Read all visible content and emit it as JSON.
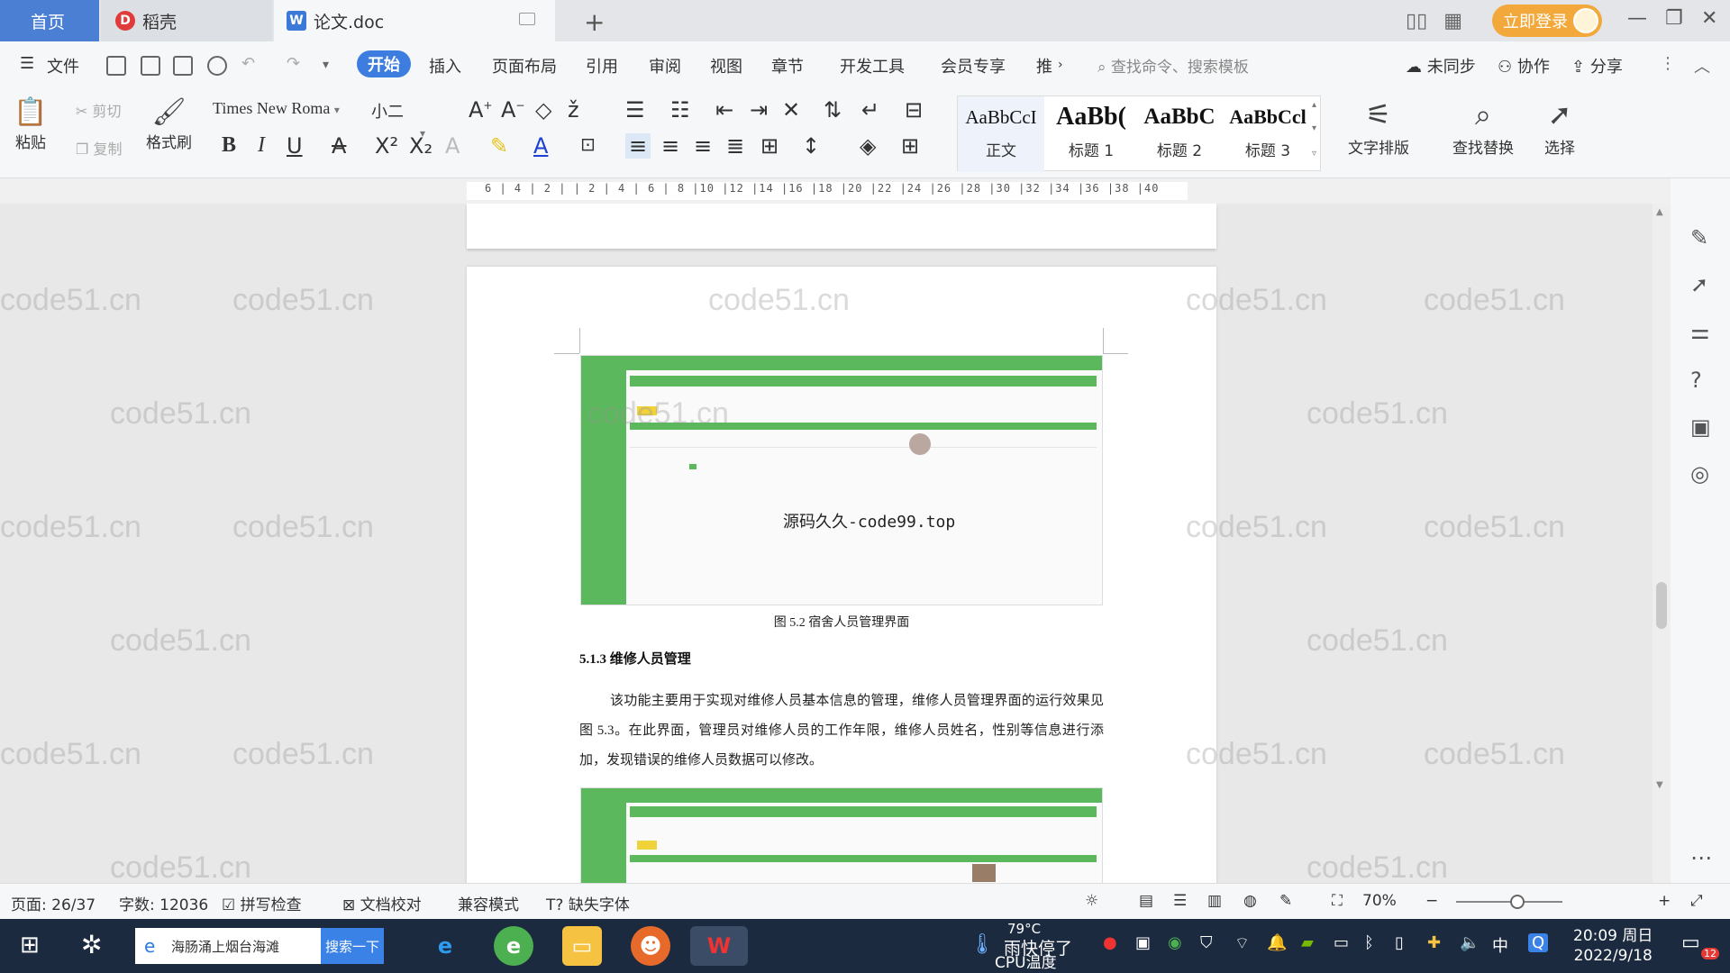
{
  "tabs": {
    "home": "首页",
    "daoke": "稻壳",
    "doc": "论文.doc"
  },
  "titlebar": {
    "login": "立即登录"
  },
  "menu": {
    "file": "文件",
    "items": [
      "开始",
      "插入",
      "页面布局",
      "引用",
      "审阅",
      "视图",
      "章节",
      "开发工具",
      "会员专享",
      "推"
    ],
    "search_cmd": "查找命令、搜索模板",
    "unsynced": "未同步",
    "collab": "协作",
    "share": "分享"
  },
  "ribbon": {
    "paste": "粘贴",
    "cut": "剪切",
    "copy": "复制",
    "format_painter": "格式刷",
    "font_name": "Times New Roma",
    "font_size": "小二",
    "styles": [
      {
        "preview": "AaBbCcI",
        "name": "正文"
      },
      {
        "preview": "AaBb(",
        "name": "标题 1"
      },
      {
        "preview": "AaBbC",
        "name": "标题 2"
      },
      {
        "preview": "AaBbCcl",
        "name": "标题 3"
      }
    ],
    "text_layout": "文字排版",
    "find_replace": "查找替换",
    "select": "选择"
  },
  "ruler": {
    "ticks": "6 | 4 | 2 |   | 2 | 4 | 6 | 8 |10 |12 |14 |16 |18 |20 |22 |24 |26 |28 |30 |32 |34 |36 |38 |40"
  },
  "document": {
    "image_overlay_text": "源码久久-code99.top",
    "figure_caption": "图 5.2  宿舍人员管理界面",
    "section_heading": "5.1.3  维修人员管理",
    "paragraph": "该功能主要用于实现对维修人员基本信息的管理，维修人员管理界面的运行效果见图 5.3。在此界面，管理员对维修人员的工作年限，维修人员姓名，性别等信息进行添加，发现错误的维修人员数据可以修改。",
    "watermark": "code51.cn"
  },
  "statusbar": {
    "page": "页面: 26/37",
    "words": "字数: 12036",
    "spell": "拼写检查",
    "proof": "文档校对",
    "compat": "兼容模式",
    "missing_font": "缺失字体",
    "zoom": "70%"
  },
  "taskbar": {
    "search_text": "海肠涌上烟台海滩",
    "search_btn": "搜索一下",
    "weather_temp": "79°C",
    "weather_text": "雨快停了",
    "cpu_label": "CPU温度",
    "ime": "中",
    "time": "20:09 周日",
    "date": "2022/9/18",
    "notif_count": "12"
  },
  "colors": {
    "accent_blue": "#3d7de0",
    "login_orange": "#f3a83b",
    "green_ui": "#5cb85c",
    "taskbar": "#1b2a3f"
  }
}
